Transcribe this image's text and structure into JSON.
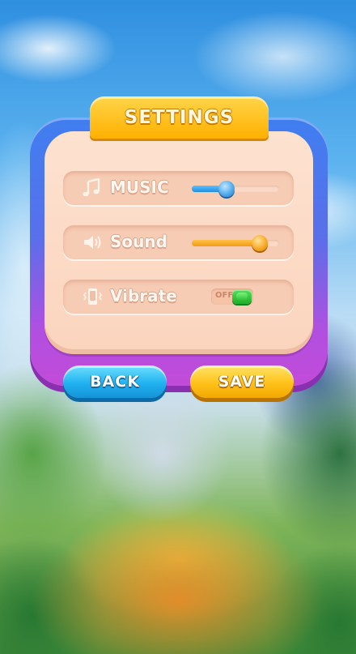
{
  "title": "SETTINGS",
  "options": [
    {
      "label": "MUSIC",
      "icon": "music-note-icon",
      "control": "slider",
      "value": 0.4,
      "accent": "#2b95e6"
    },
    {
      "label": "Sound",
      "icon": "speaker-icon",
      "control": "slider",
      "value": 0.78,
      "accent": "#f5a623"
    },
    {
      "label": "Vibrate",
      "icon": "vibrate-phone-icon",
      "control": "toggle",
      "state_text": "OFF",
      "accent": "#2fc23a"
    }
  ],
  "buttons": {
    "back_label": "BACK",
    "save_label": "SAVE"
  },
  "colors": {
    "panel_top": "#3f7ff0",
    "panel_bottom": "#c24bd8",
    "title_tab": "#ffb000",
    "back_button": "#20b2f0",
    "save_button": "#ffc21a"
  }
}
